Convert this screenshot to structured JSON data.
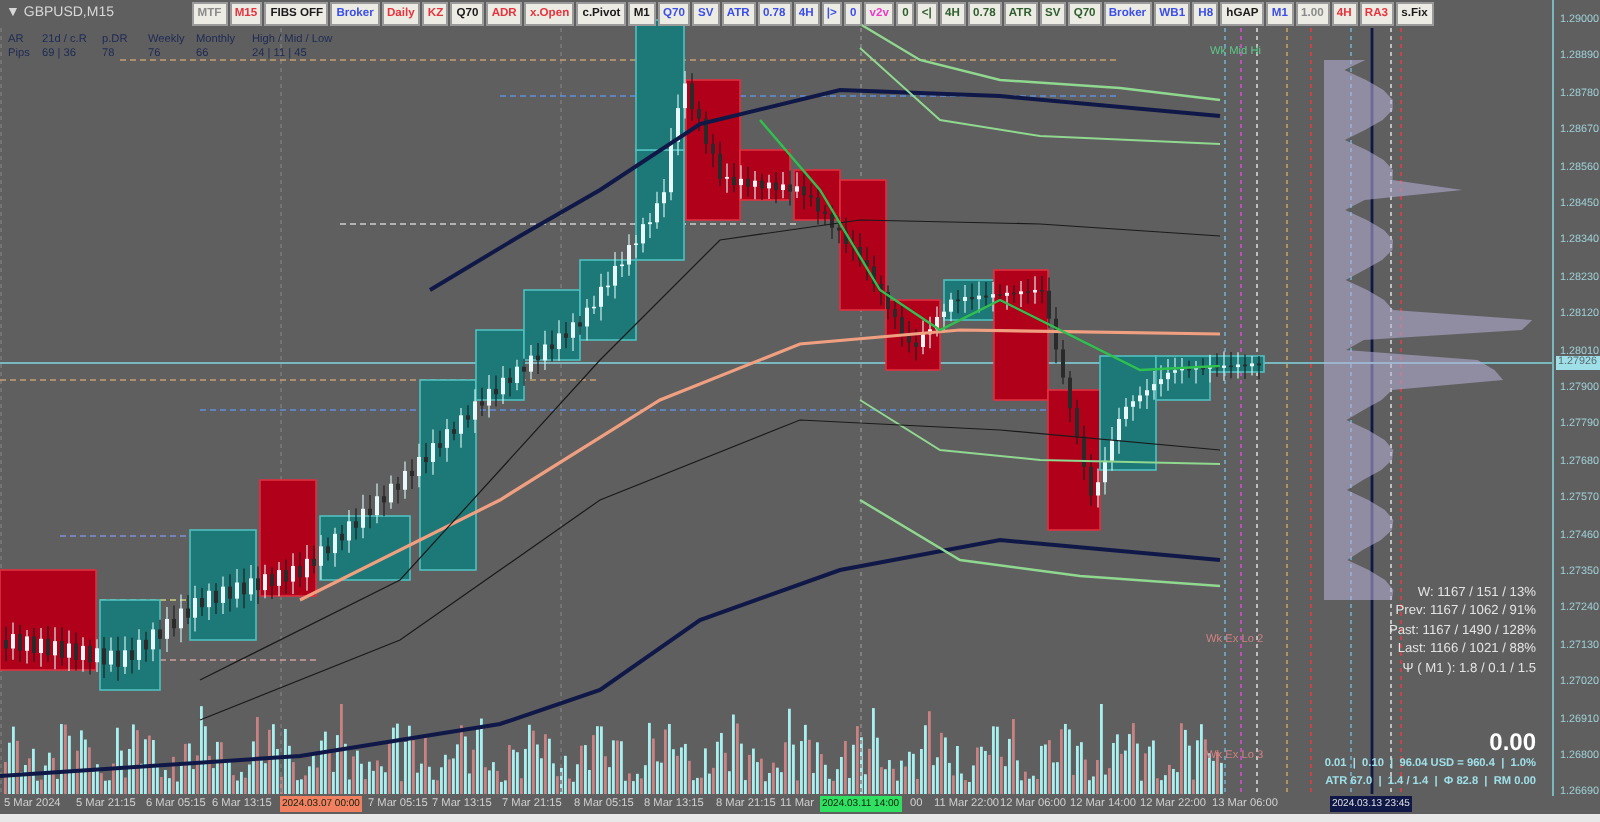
{
  "chart_window": {
    "collapse_glyph": "▼",
    "symbol": "GBPUSD,M15"
  },
  "toolbar": [
    {
      "label": "MTF",
      "color": "#8a8a8a"
    },
    {
      "label": "M15",
      "color": "#e8323c"
    },
    {
      "label": "FIBS OFF",
      "color": "#1a1a1a"
    },
    {
      "label": "Broker",
      "color": "#3a4ee8"
    },
    {
      "label": "Daily",
      "color": "#e8323c"
    },
    {
      "label": "KZ",
      "color": "#e8323c"
    },
    {
      "label": "Q70",
      "color": "#1a1a1a"
    },
    {
      "label": "ADR",
      "color": "#e8323c"
    },
    {
      "label": "x.Open",
      "color": "#e8323c"
    },
    {
      "label": "c.Pivot",
      "color": "#1a1a1a"
    },
    {
      "label": "M1",
      "color": "#1a1a1a"
    },
    {
      "label": "Q70",
      "color": "#3a4ee8"
    },
    {
      "label": "SV",
      "color": "#3a4ee8"
    },
    {
      "label": "ATR",
      "color": "#3a4ee8"
    },
    {
      "label": "0.78",
      "color": "#3a4ee8"
    },
    {
      "label": "4H",
      "color": "#3a4ee8"
    },
    {
      "label": "|>",
      "color": "#3a4ee8"
    },
    {
      "label": "0",
      "color": "#3a4ee8"
    },
    {
      "label": "v2v",
      "color": "#e83cc8"
    },
    {
      "label": "0",
      "color": "#2e5e2e"
    },
    {
      "label": "<|",
      "color": "#2e5e2e"
    },
    {
      "label": "4H",
      "color": "#2e5e2e"
    },
    {
      "label": "0.78",
      "color": "#2e5e2e"
    },
    {
      "label": "ATR",
      "color": "#2e5e2e"
    },
    {
      "label": "SV",
      "color": "#2e5e2e"
    },
    {
      "label": "Q70",
      "color": "#2e5e2e"
    },
    {
      "label": "Broker",
      "color": "#3a4ee8"
    },
    {
      "label": "WB1",
      "color": "#3a4ee8"
    },
    {
      "label": "H8",
      "color": "#3a4ee8"
    },
    {
      "label": "hGAP",
      "color": "#1a1a1a"
    },
    {
      "label": "M1",
      "color": "#3a4ee8"
    },
    {
      "label": "1.00",
      "color": "#8a8a8a"
    },
    {
      "label": "4H",
      "color": "#e8323c"
    },
    {
      "label": "RA3",
      "color": "#e8323c"
    },
    {
      "label": "s.Fix",
      "color": "#1a1a1a"
    }
  ],
  "stats": {
    "header": [
      "AR",
      "21d / c.R",
      "p.DR",
      "Weekly",
      "Monthly",
      "High / Mid / Low"
    ],
    "values": [
      "Pips",
      "69 | 36",
      "78",
      "76",
      "66",
      "24 | 11 | 45"
    ]
  },
  "chart_labels": [
    {
      "text": "Wk Mid Hi",
      "color": "#5fc88a"
    },
    {
      "text": "Wk Ex Lo 2",
      "color": "#d08080"
    },
    {
      "text": "Wk Ex Lo 3",
      "color": "#d08080"
    }
  ],
  "price_axis": [
    {
      "label": "1.29000",
      "kind": "tick"
    },
    {
      "label": "1.28890",
      "kind": "tick"
    },
    {
      "label": "1.28780",
      "kind": "tick"
    },
    {
      "label": "1.28670",
      "kind": "tick"
    },
    {
      "label": "1.28560",
      "kind": "tick"
    },
    {
      "label": "1.28450",
      "kind": "tick"
    },
    {
      "label": "1.28340",
      "kind": "tick"
    },
    {
      "label": "1.28230",
      "kind": "tick"
    },
    {
      "label": "1.28120",
      "kind": "tick"
    },
    {
      "label": "1.28010",
      "kind": "tick"
    },
    {
      "label": "1.27926",
      "kind": "current"
    },
    {
      "label": "1.27900",
      "kind": "tick"
    },
    {
      "label": "1.27790",
      "kind": "tick"
    },
    {
      "label": "1.27680",
      "kind": "tick"
    },
    {
      "label": "1.27570",
      "kind": "tick"
    },
    {
      "label": "1.27460",
      "kind": "tick"
    },
    {
      "label": "1.27350",
      "kind": "tick"
    },
    {
      "label": "1.27240",
      "kind": "tick"
    },
    {
      "label": "1.27130",
      "kind": "tick"
    },
    {
      "label": "1.27020",
      "kind": "tick"
    },
    {
      "label": "1.26910",
      "kind": "tick"
    },
    {
      "label": "1.26800",
      "kind": "tick"
    },
    {
      "label": "1.26690",
      "kind": "tick"
    }
  ],
  "time_axis": [
    {
      "label": "5 Mar 2024",
      "kind": "tick"
    },
    {
      "label": "5 Mar 21:15",
      "kind": "tick"
    },
    {
      "label": "6 Mar 05:15",
      "kind": "tick"
    },
    {
      "label": "6 Mar 13:15",
      "kind": "tick"
    },
    {
      "label": "2024.03.07 00:00",
      "kind": "highlight",
      "color": "#f08060"
    },
    {
      "label": "7 Mar 05:15",
      "kind": "tick"
    },
    {
      "label": "7 Mar 13:15",
      "kind": "tick"
    },
    {
      "label": "7 Mar 21:15",
      "kind": "tick"
    },
    {
      "label": "8 Mar 05:15",
      "kind": "tick"
    },
    {
      "label": "8 Mar 13:15",
      "kind": "tick"
    },
    {
      "label": "8 Mar 21:15",
      "kind": "tick"
    },
    {
      "label": "11 Mar",
      "kind": "tick"
    },
    {
      "label": "2024.03.11 14:00",
      "kind": "highlight",
      "color": "#30e060"
    },
    {
      "label": "00",
      "kind": "tick"
    },
    {
      "label": "11 Mar 22:00",
      "kind": "tick"
    },
    {
      "label": "12 Mar 06:00",
      "kind": "tick"
    },
    {
      "label": "12 Mar 14:00",
      "kind": "tick"
    },
    {
      "label": "12 Mar 22:00",
      "kind": "tick"
    },
    {
      "label": "13 Mar 06:00",
      "kind": "tick"
    },
    {
      "label": "2024.03.13 23:45",
      "kind": "highlight",
      "color": "#101848"
    }
  ],
  "info_panel": {
    "lines": [
      "W: 1167 / 151 / 13%",
      "Prev: 1167 / 1062 / 91%",
      "Past: 1167 / 1490 / 128%",
      "Last: 1166 / 1021 / 88%",
      "Ψ ( M1 ): 1.8 / 0.1 / 1.5"
    ],
    "balance": "0.00",
    "footer": [
      "0.01  |  0.10  |  96.04 USD = 960.4  |  1.0%",
      "ATR 67.0  |  1.4 / 1.4  |  Ф 82.8  |  RM 0.00"
    ]
  }
}
